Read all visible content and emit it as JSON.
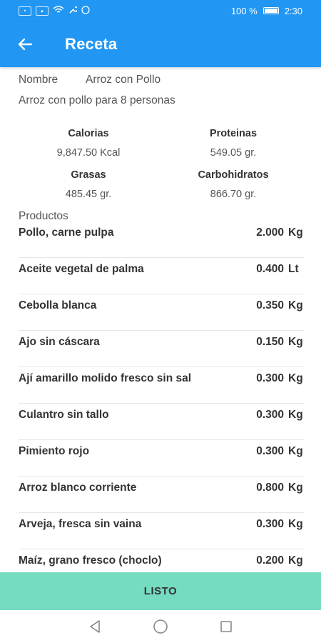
{
  "status_bar": {
    "battery": "100 %",
    "time": "2:30"
  },
  "app_bar": {
    "title": "Receta"
  },
  "recipe": {
    "name_label": "Nombre",
    "name_value": "Arroz con Pollo",
    "description": "Arroz con pollo para 8 personas"
  },
  "nutrition": [
    {
      "label": "Calorias",
      "value": "9,847.50 Kcal"
    },
    {
      "label": "Proteinas",
      "value": "549.05 gr."
    },
    {
      "label": "Grasas",
      "value": "485.45 gr."
    },
    {
      "label": "Carbohidratos",
      "value": "866.70 gr."
    }
  ],
  "products_label": "Productos",
  "products": [
    {
      "name": "Pollo, carne pulpa",
      "qty": "2.000",
      "unit": "Kg"
    },
    {
      "name": "Aceite vegetal de palma",
      "qty": "0.400",
      "unit": "Lt"
    },
    {
      "name": "Cebolla blanca",
      "qty": "0.350",
      "unit": "Kg"
    },
    {
      "name": "Ajo sin cáscara",
      "qty": "0.150",
      "unit": "Kg"
    },
    {
      "name": "Ají amarillo molido fresco sin sal",
      "qty": "0.300",
      "unit": "Kg"
    },
    {
      "name": "Culantro sin tallo",
      "qty": "0.300",
      "unit": "Kg"
    },
    {
      "name": "Pimiento rojo",
      "qty": "0.300",
      "unit": "Kg"
    },
    {
      "name": "Arroz blanco corriente",
      "qty": "0.800",
      "unit": "Kg"
    },
    {
      "name": "Arveja, fresca sin vaina",
      "qty": "0.300",
      "unit": "Kg"
    },
    {
      "name": "Maíz, grano fresco (choclo)",
      "qty": "0.200",
      "unit": "Kg"
    }
  ],
  "button": {
    "listo": "LISTO"
  },
  "icons": {
    "back": "arrow-left-icon",
    "nav_back": "triangle-back-icon",
    "nav_home": "circle-home-icon",
    "nav_recents": "square-recents-icon"
  },
  "colors": {
    "primary": "#2196f3",
    "accent_button": "#75dbc1"
  }
}
